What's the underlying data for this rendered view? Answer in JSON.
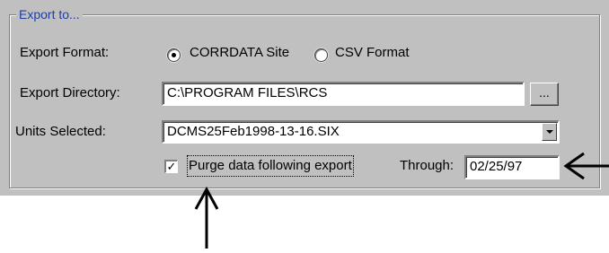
{
  "group": {
    "title": "Export to..."
  },
  "export_format": {
    "label": "Export Format:",
    "options": [
      {
        "label": "CORRDATA Site",
        "selected": true
      },
      {
        "label": "CSV Format",
        "selected": false
      }
    ]
  },
  "export_directory": {
    "label": "Export Directory:",
    "value": "C:\\PROGRAM FILES\\RCS",
    "browse_label": "..."
  },
  "units_selected": {
    "label": "Units Selected:",
    "value": "DCMS25Feb1998-13-16.SIX"
  },
  "purge": {
    "checked": true,
    "check_mark": "✓",
    "label": "Purge data following export"
  },
  "through": {
    "label": "Through:",
    "value": "02/25/97"
  },
  "colors": {
    "dialog_bg": "#c0c0c0",
    "group_title": "#1f3fa0",
    "annotation_arrows": "#000000"
  },
  "annotations": [
    "right-pointing arrow to Through date",
    "upward arrow to Purge checkbox"
  ]
}
